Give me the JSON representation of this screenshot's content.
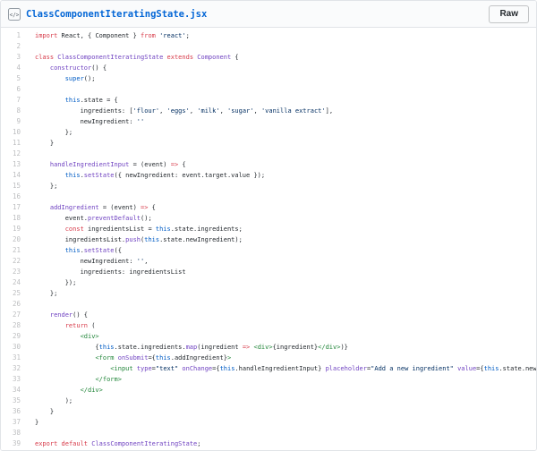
{
  "header": {
    "filename": "ClassComponentIteratingState.jsx",
    "raw_button": "Raw"
  },
  "colors": {
    "plain": "#24292e",
    "keyword": "#d73a49",
    "string": "#032f62",
    "function": "#6f42c1",
    "constant": "#005cc5",
    "tag": "#22863a",
    "line_number": "rgba(27,31,35,0.3)",
    "link": "#0366d6",
    "header_bg": "#fafbfc",
    "border": "#e1e4e8"
  },
  "code": {
    "language": "jsx",
    "line_count": 39,
    "lines": [
      {
        "num": 1,
        "tokens": [
          [
            "kw",
            "import"
          ],
          [
            "pl",
            " React, { Component } "
          ],
          [
            "kw",
            "from"
          ],
          [
            "pl",
            " "
          ],
          [
            "st",
            "'react'"
          ],
          [
            "pl",
            ";"
          ]
        ]
      },
      {
        "num": 2,
        "tokens": []
      },
      {
        "num": 3,
        "tokens": [
          [
            "kw",
            "class"
          ],
          [
            "pl",
            " "
          ],
          [
            "fn",
            "ClassComponentIteratingState"
          ],
          [
            "pl",
            " "
          ],
          [
            "kw",
            "extends"
          ],
          [
            "pl",
            " "
          ],
          [
            "fn",
            "Component"
          ],
          [
            "pl",
            " {"
          ]
        ]
      },
      {
        "num": 4,
        "tokens": [
          [
            "pl",
            "    "
          ],
          [
            "fn",
            "constructor"
          ],
          [
            "pl",
            "() {"
          ]
        ]
      },
      {
        "num": 5,
        "tokens": [
          [
            "pl",
            "        "
          ],
          [
            "cn",
            "super"
          ],
          [
            "pl",
            "();"
          ]
        ]
      },
      {
        "num": 6,
        "tokens": []
      },
      {
        "num": 7,
        "tokens": [
          [
            "pl",
            "        "
          ],
          [
            "cn",
            "this"
          ],
          [
            "pl",
            ".state = {"
          ]
        ]
      },
      {
        "num": 8,
        "tokens": [
          [
            "pl",
            "            ingredients: ["
          ],
          [
            "st",
            "'flour'"
          ],
          [
            "pl",
            ", "
          ],
          [
            "st",
            "'eggs'"
          ],
          [
            "pl",
            ", "
          ],
          [
            "st",
            "'milk'"
          ],
          [
            "pl",
            ", "
          ],
          [
            "st",
            "'sugar'"
          ],
          [
            "pl",
            ", "
          ],
          [
            "st",
            "'vanilla extract'"
          ],
          [
            "pl",
            "],"
          ]
        ]
      },
      {
        "num": 9,
        "tokens": [
          [
            "pl",
            "            newIngredient: "
          ],
          [
            "st",
            "''"
          ]
        ]
      },
      {
        "num": 10,
        "tokens": [
          [
            "pl",
            "        };"
          ]
        ]
      },
      {
        "num": 11,
        "tokens": [
          [
            "pl",
            "    }"
          ]
        ]
      },
      {
        "num": 12,
        "tokens": []
      },
      {
        "num": 13,
        "tokens": [
          [
            "pl",
            "    "
          ],
          [
            "fn",
            "handleIngredientInput"
          ],
          [
            "pl",
            " = (event) "
          ],
          [
            "kw",
            "=>"
          ],
          [
            "pl",
            " {"
          ]
        ]
      },
      {
        "num": 14,
        "tokens": [
          [
            "pl",
            "        "
          ],
          [
            "cn",
            "this"
          ],
          [
            "pl",
            "."
          ],
          [
            "fn",
            "setState"
          ],
          [
            "pl",
            "({ newIngredient: event.target.value });"
          ]
        ]
      },
      {
        "num": 15,
        "tokens": [
          [
            "pl",
            "    };"
          ]
        ]
      },
      {
        "num": 16,
        "tokens": []
      },
      {
        "num": 17,
        "tokens": [
          [
            "pl",
            "    "
          ],
          [
            "fn",
            "addIngredient"
          ],
          [
            "pl",
            " = (event) "
          ],
          [
            "kw",
            "=>"
          ],
          [
            "pl",
            " {"
          ]
        ]
      },
      {
        "num": 18,
        "tokens": [
          [
            "pl",
            "        event."
          ],
          [
            "fn",
            "preventDefault"
          ],
          [
            "pl",
            "();"
          ]
        ]
      },
      {
        "num": 19,
        "tokens": [
          [
            "pl",
            "        "
          ],
          [
            "kw",
            "const"
          ],
          [
            "pl",
            " ingredientsList = "
          ],
          [
            "cn",
            "this"
          ],
          [
            "pl",
            ".state.ingredients;"
          ]
        ]
      },
      {
        "num": 20,
        "tokens": [
          [
            "pl",
            "        ingredientsList."
          ],
          [
            "fn",
            "push"
          ],
          [
            "pl",
            "("
          ],
          [
            "cn",
            "this"
          ],
          [
            "pl",
            ".state.newIngredient);"
          ]
        ]
      },
      {
        "num": 21,
        "tokens": [
          [
            "pl",
            "        "
          ],
          [
            "cn",
            "this"
          ],
          [
            "pl",
            "."
          ],
          [
            "fn",
            "setState"
          ],
          [
            "pl",
            "({"
          ]
        ]
      },
      {
        "num": 22,
        "tokens": [
          [
            "pl",
            "            newIngredient: "
          ],
          [
            "st",
            "''"
          ],
          [
            "pl",
            ","
          ]
        ]
      },
      {
        "num": 23,
        "tokens": [
          [
            "pl",
            "            ingredients: ingredientsList"
          ]
        ]
      },
      {
        "num": 24,
        "tokens": [
          [
            "pl",
            "        });"
          ]
        ]
      },
      {
        "num": 25,
        "tokens": [
          [
            "pl",
            "    };"
          ]
        ]
      },
      {
        "num": 26,
        "tokens": []
      },
      {
        "num": 27,
        "tokens": [
          [
            "pl",
            "    "
          ],
          [
            "fn",
            "render"
          ],
          [
            "pl",
            "() {"
          ]
        ]
      },
      {
        "num": 28,
        "tokens": [
          [
            "pl",
            "        "
          ],
          [
            "kw",
            "return"
          ],
          [
            "pl",
            " ("
          ]
        ]
      },
      {
        "num": 29,
        "tokens": [
          [
            "pl",
            "            "
          ],
          [
            "tg",
            "<div>"
          ]
        ]
      },
      {
        "num": 30,
        "tokens": [
          [
            "pl",
            "                {"
          ],
          [
            "cn",
            "this"
          ],
          [
            "pl",
            ".state.ingredients."
          ],
          [
            "fn",
            "map"
          ],
          [
            "pl",
            "(ingredient "
          ],
          [
            "kw",
            "=>"
          ],
          [
            "pl",
            " "
          ],
          [
            "tg",
            "<div>"
          ],
          [
            "pl",
            "{ingredient}"
          ],
          [
            "tg",
            "</div>"
          ],
          [
            "pl",
            ")}"
          ]
        ]
      },
      {
        "num": 31,
        "tokens": [
          [
            "pl",
            "                "
          ],
          [
            "tg",
            "<form"
          ],
          [
            "pl",
            " "
          ],
          [
            "fn",
            "onSubmit"
          ],
          [
            "pl",
            "={"
          ],
          [
            "cn",
            "this"
          ],
          [
            "pl",
            ".addIngredient}"
          ],
          [
            "tg",
            ">"
          ]
        ]
      },
      {
        "num": 32,
        "tokens": [
          [
            "pl",
            "                    "
          ],
          [
            "tg",
            "<input"
          ],
          [
            "pl",
            " "
          ],
          [
            "fn",
            "type"
          ],
          [
            "pl",
            "="
          ],
          [
            "st",
            "\"text\""
          ],
          [
            "pl",
            " "
          ],
          [
            "fn",
            "onChange"
          ],
          [
            "pl",
            "={"
          ],
          [
            "cn",
            "this"
          ],
          [
            "pl",
            ".handleIngredientInput} "
          ],
          [
            "fn",
            "placeholder"
          ],
          [
            "pl",
            "="
          ],
          [
            "st",
            "\"Add a new ingredient\""
          ],
          [
            "pl",
            " "
          ],
          [
            "fn",
            "value"
          ],
          [
            "pl",
            "={"
          ],
          [
            "cn",
            "this"
          ],
          [
            "pl",
            ".state.newIngredient}"
          ]
        ]
      },
      {
        "num": 33,
        "tokens": [
          [
            "pl",
            "                "
          ],
          [
            "tg",
            "</form>"
          ]
        ]
      },
      {
        "num": 34,
        "tokens": [
          [
            "pl",
            "            "
          ],
          [
            "tg",
            "</div>"
          ]
        ]
      },
      {
        "num": 35,
        "tokens": [
          [
            "pl",
            "        );"
          ]
        ]
      },
      {
        "num": 36,
        "tokens": [
          [
            "pl",
            "    }"
          ]
        ]
      },
      {
        "num": 37,
        "tokens": [
          [
            "pl",
            "}"
          ]
        ]
      },
      {
        "num": 38,
        "tokens": []
      },
      {
        "num": 39,
        "tokens": [
          [
            "kw",
            "export"
          ],
          [
            "pl",
            " "
          ],
          [
            "kw",
            "default"
          ],
          [
            "pl",
            " "
          ],
          [
            "fn",
            "ClassComponentIteratingState"
          ],
          [
            "pl",
            ";"
          ]
        ]
      }
    ]
  }
}
